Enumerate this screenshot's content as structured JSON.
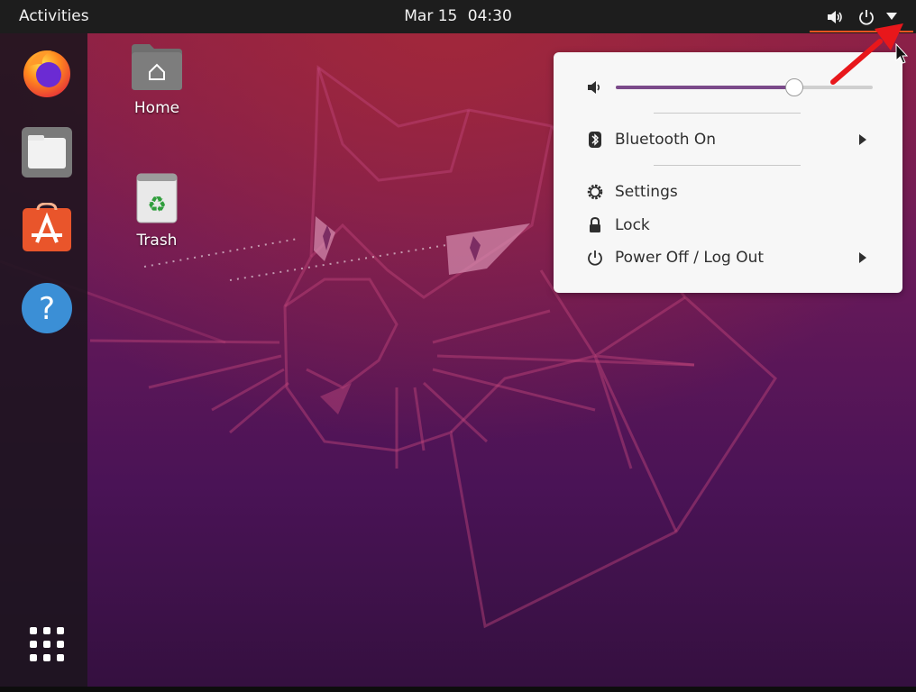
{
  "topbar": {
    "activities": "Activities",
    "date": "Mar 15",
    "time": "04:30",
    "icons": [
      "speaker-icon",
      "power-icon",
      "dropdown-arrow-icon"
    ]
  },
  "dock": {
    "apps": [
      {
        "name": "Firefox",
        "icon": "firefox-icon"
      },
      {
        "name": "Files",
        "icon": "files-icon"
      },
      {
        "name": "Ubuntu Software",
        "icon": "software-store-icon"
      },
      {
        "name": "Help",
        "icon": "help-icon"
      }
    ],
    "show_apps_icon": "grid-icon"
  },
  "desktop": {
    "icons": [
      {
        "label": "Home",
        "icon": "home-folder-icon"
      },
      {
        "label": "Trash",
        "icon": "trash-icon"
      }
    ]
  },
  "system_menu": {
    "volume": {
      "icon": "speaker-icon",
      "level": 0.69
    },
    "bluetooth": "Bluetooth On",
    "settings": "Settings",
    "lock": "Lock",
    "power": "Power Off / Log Out"
  },
  "annotation": {
    "color": "#e8171b",
    "icon": "red-arrow"
  },
  "colors": {
    "accent": "#e95420",
    "slider": "#7b4a8a",
    "topbar": "#1d1d1d"
  }
}
